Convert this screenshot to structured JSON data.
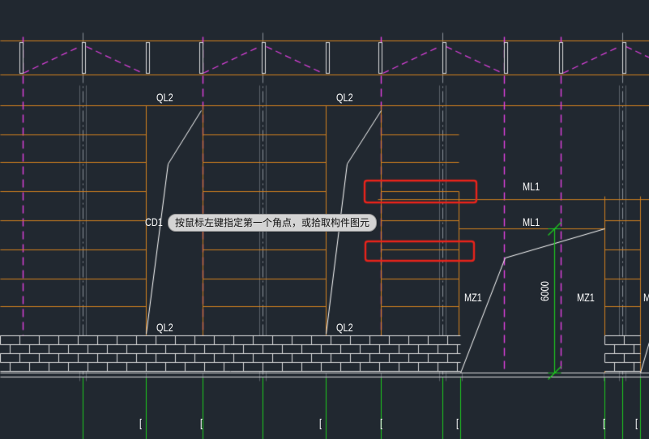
{
  "labels": {
    "ql2": "QL2",
    "ml1": "ML1",
    "mz1": "MZ1",
    "cd1": "CD1",
    "m": "M",
    "bracket": "[",
    "dimension": "6000"
  },
  "tooltip": {
    "text": "按鼠标左键指定第一个角点，或拾取构件图元"
  },
  "colors": {
    "background": "#212830",
    "beam": "#d2801e",
    "magenta": "#e040e0",
    "selection": "#e8231b",
    "dimension": "#1ec81e",
    "wall": "#dcdcdc",
    "grid": "#9aa0a8"
  }
}
